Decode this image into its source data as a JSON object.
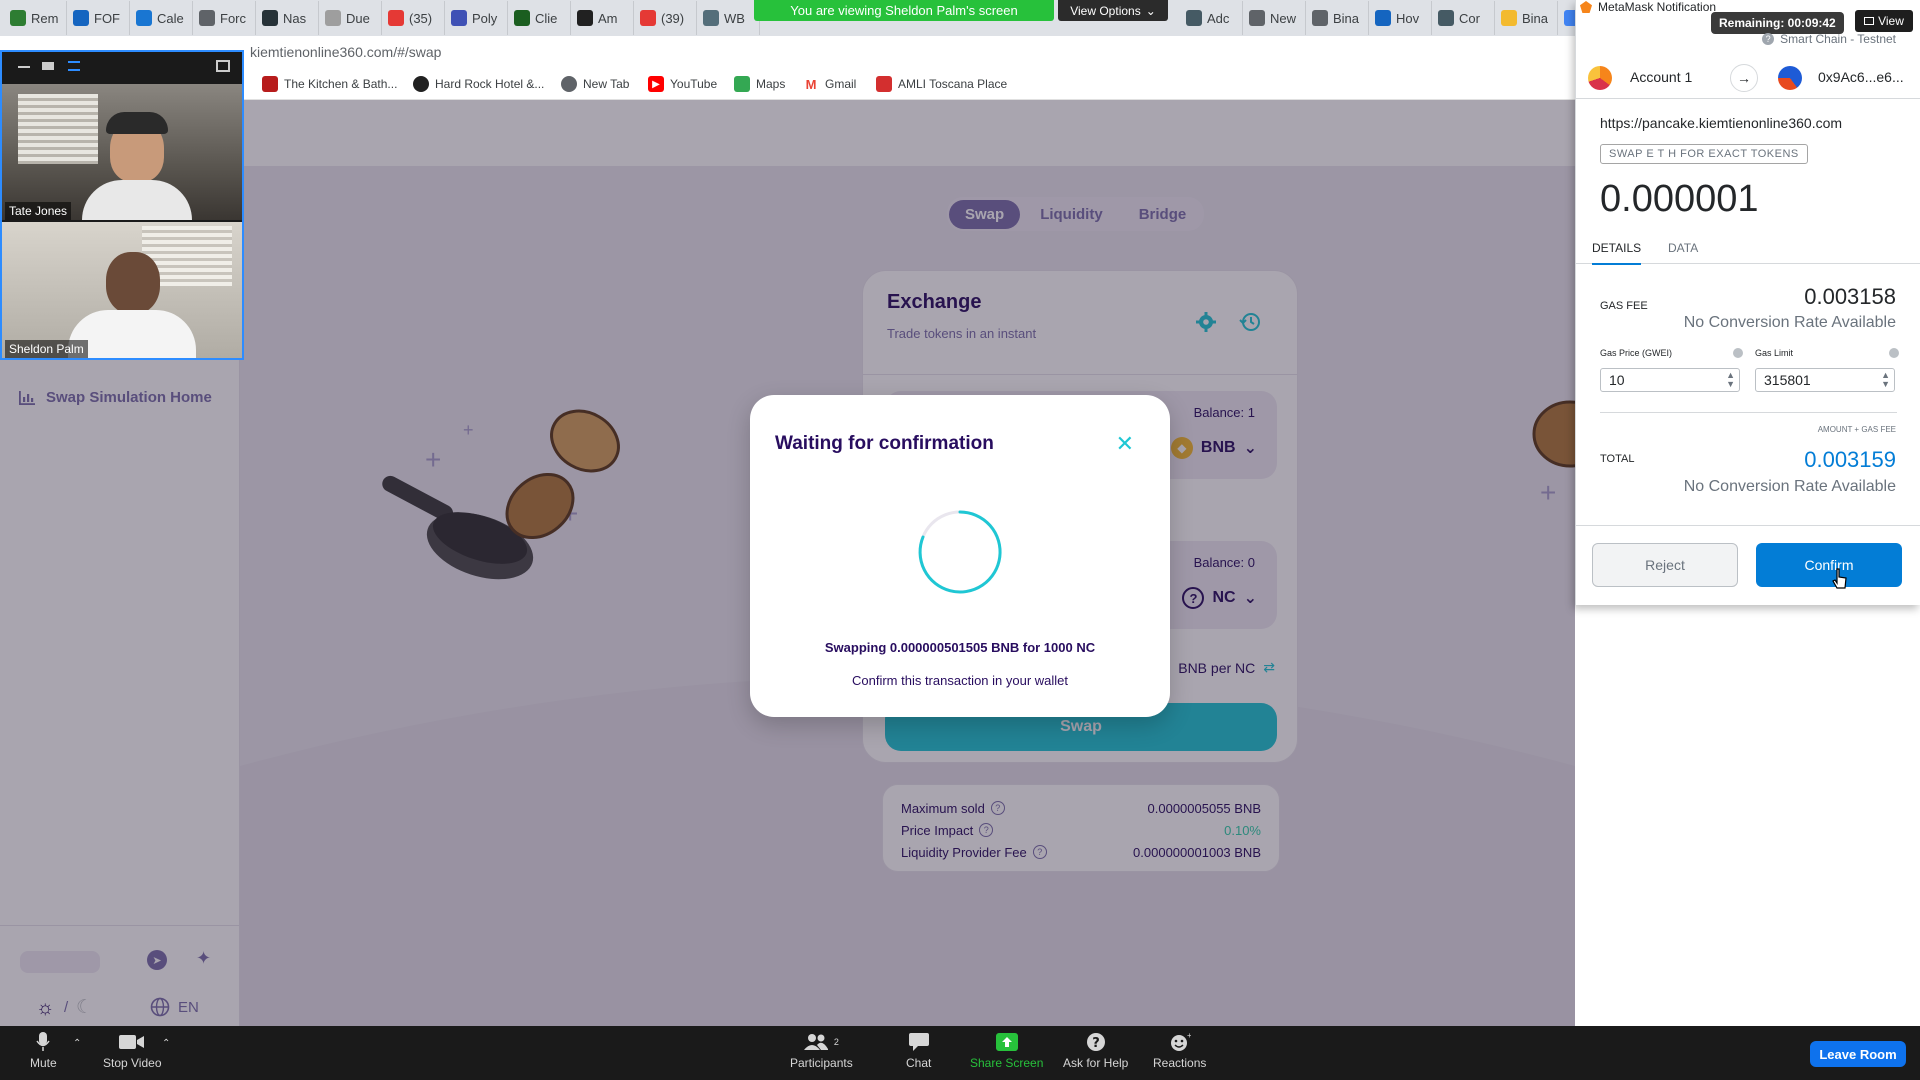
{
  "browser": {
    "tabs": [
      {
        "label": "Rem",
        "color": "#2e7d32"
      },
      {
        "label": "FOF",
        "color": "#1565c0"
      },
      {
        "label": "Cale",
        "color": "#1976d2"
      },
      {
        "label": "Forc",
        "color": "#5f6368"
      },
      {
        "label": "Nas",
        "color": "#263238"
      },
      {
        "label": "Due",
        "color": "#9e9e9e"
      },
      {
        "label": "(35)",
        "color": "#e53935"
      },
      {
        "label": "Poly",
        "color": "#3f51b5"
      },
      {
        "label": "Clie",
        "color": "#1b5e20"
      },
      {
        "label": "Am",
        "color": "#212121"
      },
      {
        "label": "(39)",
        "color": "#e53935"
      },
      {
        "label": "WB",
        "color": "#546e7a"
      }
    ],
    "tabs_right": [
      {
        "label": "Adc",
        "color": "#455a64"
      },
      {
        "label": "New",
        "color": "#5f6368"
      },
      {
        "label": "Bina",
        "color": "#5f6368"
      },
      {
        "label": "Hov",
        "color": "#1565c0"
      },
      {
        "label": "Cor",
        "color": "#455a64"
      },
      {
        "label": "Bina",
        "color": "#f3ba2f"
      },
      {
        "label": "p",
        "color": "#4285f4"
      }
    ],
    "share_banner": "You are viewing Sheldon Palm's screen",
    "view_options": "View Options",
    "url": "kiemtienonline360.com/#/swap",
    "bookmarks": [
      "The Kitchen & Bath...",
      "Hard Rock Hotel &...",
      "New Tab",
      "YouTube",
      "Maps",
      "Gmail",
      "AMLI Toscana Place"
    ]
  },
  "video": {
    "participants": [
      {
        "name": "Tate Jones"
      },
      {
        "name": "Sheldon Palm"
      }
    ]
  },
  "sidebar": {
    "home_link": "Swap Simulation Home",
    "language": "EN"
  },
  "swap": {
    "tabs": [
      "Swap",
      "Liquidity",
      "Bridge"
    ],
    "active_tab": "Swap",
    "card": {
      "title": "Exchange",
      "subtitle": "Trade tokens in an instant",
      "from_balance": "Balance: 1",
      "from_token": "BNB",
      "to_balance": "Balance: 0",
      "to_token": "NC",
      "rate_suffix": "BNB per NC",
      "swap_button": "Swap"
    },
    "details": [
      {
        "label": "Maximum sold",
        "value": "0.0000005055 BNB",
        "color": "#280d5f"
      },
      {
        "label": "Price Impact",
        "value": "0.10%",
        "color": "#31d0aa"
      },
      {
        "label": "Liquidity Provider Fee",
        "value": "0.000000001003 BNB",
        "color": "#280d5f"
      }
    ]
  },
  "modal": {
    "title": "Waiting for confirmation",
    "swap_text": "Swapping 0.000000501505 BNB for 1000 NC",
    "confirm_text": "Confirm this transaction in your wallet"
  },
  "metamask": {
    "window_title": "MetaMask Notification",
    "remaining": "Remaining: 00:09:42",
    "view": "View",
    "network": "Smart Chain - Testnet",
    "account_from": "Account 1",
    "account_to": "0x9Ac6...e6...",
    "origin": "https://pancake.kiemtienonline360.com",
    "method": "SWAP E T H FOR EXACT TOKENS",
    "amount": "0.000001",
    "tabs": [
      "DETAILS",
      "DATA"
    ],
    "gas_fee_label": "GAS FEE",
    "gas_fee": "0.003158",
    "no_rate": "No Conversion Rate Available",
    "gas_price_label": "Gas Price (GWEI)",
    "gas_price": "10",
    "gas_limit_label": "Gas Limit",
    "gas_limit": "315801",
    "amount_plus_gas": "AMOUNT + GAS FEE",
    "total_label": "TOTAL",
    "total": "0.003159",
    "reject": "Reject",
    "confirm": "Confirm"
  },
  "zoom": {
    "mute": "Mute",
    "stop_video": "Stop Video",
    "participants": "Participants",
    "participants_count": "2",
    "chat": "Chat",
    "share_screen": "Share Screen",
    "ask_help": "Ask for Help",
    "reactions": "Reactions",
    "leave": "Leave Room"
  },
  "colors": {
    "accent": "#1fc7d4",
    "primary_text": "#280d5f",
    "secondary_text": "#7a6eaa",
    "metamask_blue": "#037dd6",
    "zoom_green": "#27c13b",
    "zoom_blue": "#0e72ed"
  }
}
